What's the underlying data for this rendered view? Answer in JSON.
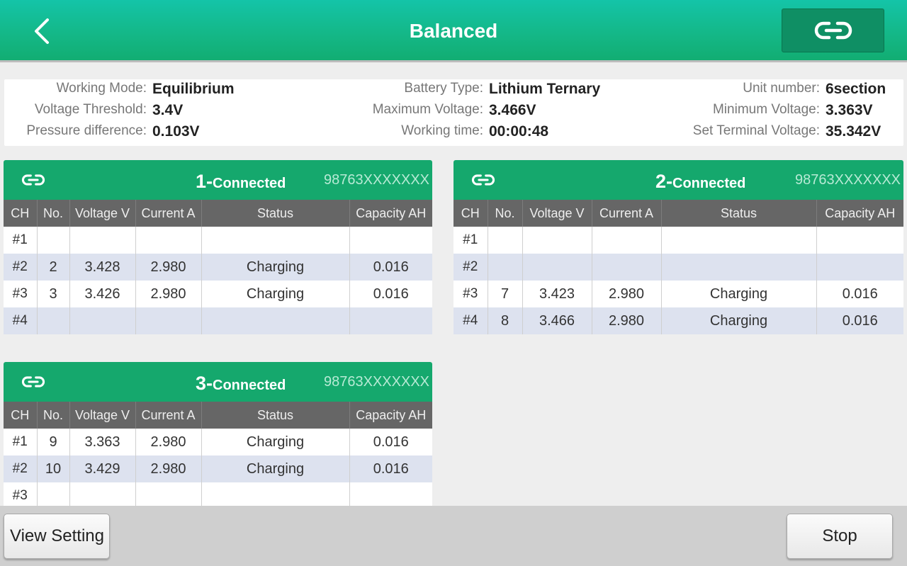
{
  "header": {
    "title": "Balanced",
    "back_icon": "chevron-left-icon",
    "link_icon": "link-icon"
  },
  "info": {
    "working_mode_label": "Working Mode:",
    "working_mode": "Equilibrium",
    "battery_type_label": "Battery Type:",
    "battery_type": "Lithium Ternary",
    "unit_number_label": "Unit number:",
    "unit_number": "6section",
    "voltage_threshold_label": "Voltage Threshold:",
    "voltage_threshold": "3.4V",
    "max_voltage_label": "Maximum Voltage:",
    "max_voltage": "3.466V",
    "min_voltage_label": "Minimum Voltage:",
    "min_voltage": "3.363V",
    "pressure_diff_label": "Pressure difference:",
    "pressure_diff": "0.103V",
    "working_time_label": "Working time:",
    "working_time": "00:00:48",
    "terminal_voltage_label": "Set Terminal Voltage:",
    "terminal_voltage": "35.342V"
  },
  "columns": [
    "CH",
    "No.",
    "Voltage V",
    "Current A",
    "Status",
    "Capacity AH"
  ],
  "panels": [
    {
      "number": "1-",
      "status": "Connected",
      "serial": "98763XXXXXXX",
      "rows": [
        {
          "ch": "#1",
          "no": "",
          "voltage": "",
          "current": "",
          "status": "",
          "capacity": ""
        },
        {
          "ch": "#2",
          "no": "2",
          "voltage": "3.428",
          "current": "2.980",
          "status": "Charging",
          "capacity": "0.016"
        },
        {
          "ch": "#3",
          "no": "3",
          "voltage": "3.426",
          "current": "2.980",
          "status": "Charging",
          "capacity": "0.016"
        },
        {
          "ch": "#4",
          "no": "",
          "voltage": "",
          "current": "",
          "status": "",
          "capacity": ""
        }
      ]
    },
    {
      "number": "2-",
      "status": "Connected",
      "serial": "98763XXXXXXX",
      "rows": [
        {
          "ch": "#1",
          "no": "",
          "voltage": "",
          "current": "",
          "status": "",
          "capacity": ""
        },
        {
          "ch": "#2",
          "no": "",
          "voltage": "",
          "current": "",
          "status": "",
          "capacity": ""
        },
        {
          "ch": "#3",
          "no": "7",
          "voltage": "3.423",
          "current": "2.980",
          "status": "Charging",
          "capacity": "0.016"
        },
        {
          "ch": "#4",
          "no": "8",
          "voltage": "3.466",
          "current": "2.980",
          "status": "Charging",
          "capacity": "0.016"
        }
      ]
    },
    {
      "number": "3-",
      "status": "Connected",
      "serial": "98763XXXXXXX",
      "rows": [
        {
          "ch": "#1",
          "no": "9",
          "voltage": "3.363",
          "current": "2.980",
          "status": "Charging",
          "capacity": "0.016"
        },
        {
          "ch": "#2",
          "no": "10",
          "voltage": "3.429",
          "current": "2.980",
          "status": "Charging",
          "capacity": "0.016"
        },
        {
          "ch": "#3",
          "no": "",
          "voltage": "",
          "current": "",
          "status": "",
          "capacity": ""
        }
      ]
    }
  ],
  "footer": {
    "view_setting_label": "View Setting",
    "stop_label": "Stop"
  },
  "colors": {
    "header_green": "#14b888",
    "panel_green": "#15a86d",
    "table_header": "#666666",
    "row_alt": "#dde2ef"
  }
}
